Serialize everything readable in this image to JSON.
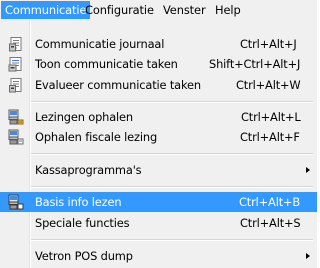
{
  "menubar": {
    "items": [
      {
        "label": "Communicatie"
      },
      {
        "label": "Configuratie"
      },
      {
        "label": "Venster"
      },
      {
        "label": "Help"
      }
    ]
  },
  "menu": {
    "items": [
      {
        "label": "Communicatie journaal",
        "shortcut": "Ctrl+Alt+J",
        "icon": "journal-icon"
      },
      {
        "label": "Toon communicatie taken",
        "shortcut": "Shift+Ctrl+Alt+J",
        "icon": "tasks-icon"
      },
      {
        "label": "Evalueer communicatie taken",
        "shortcut": "Ctrl+Alt+W",
        "icon": "evaluate-icon"
      },
      {
        "label": "Lezingen ophalen",
        "shortcut": "Ctrl+Alt+L",
        "icon": "readings-icon"
      },
      {
        "label": "Ophalen fiscale lezing",
        "shortcut": "Ctrl+Alt+F",
        "icon": "fiscal-reading-icon"
      },
      {
        "label": "Kassaprogramma's",
        "shortcut": "",
        "icon": ""
      },
      {
        "label": "Basis info lezen",
        "shortcut": "Ctrl+Alt+B",
        "icon": "basic-info-icon"
      },
      {
        "label": "Speciale functies",
        "shortcut": "Ctrl+Alt+S",
        "icon": ""
      },
      {
        "label": "Vetron POS dump",
        "shortcut": "",
        "icon": ""
      }
    ]
  },
  "colors": {
    "highlight": "#3399ff",
    "menu_bg": "#f0f0f0"
  }
}
